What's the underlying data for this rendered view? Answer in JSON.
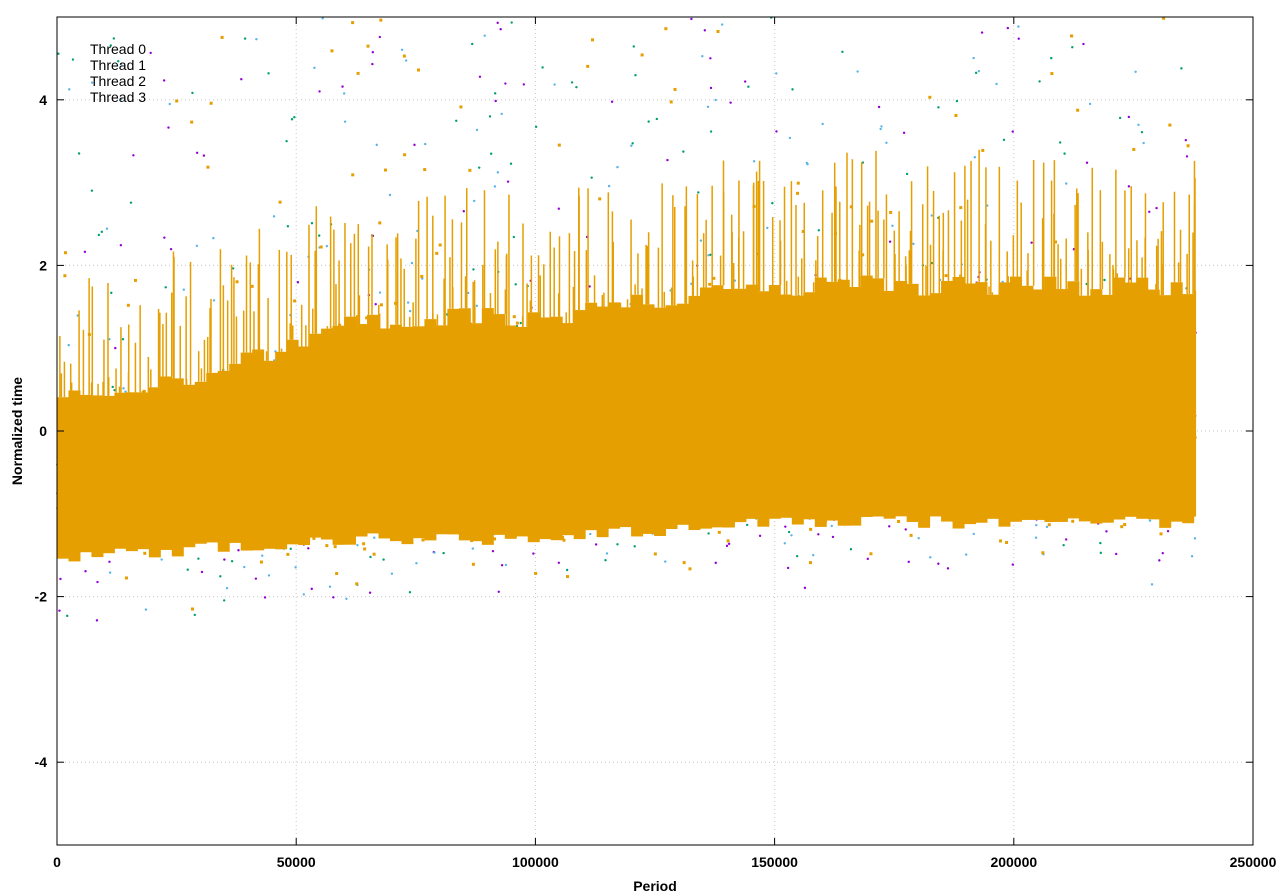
{
  "chart_data": {
    "type": "scatter",
    "title": "",
    "xlabel": "Period",
    "ylabel": "Normalized time",
    "xlim": [
      0,
      250000
    ],
    "ylim": [
      -5,
      5
    ],
    "x_ticks": [
      0,
      50000,
      100000,
      150000,
      200000,
      250000
    ],
    "x_tick_labels": [
      "0",
      "50000",
      "100000",
      "150000",
      "200000",
      "250000"
    ],
    "y_ticks": [
      -4,
      -2,
      0,
      2,
      4
    ],
    "y_tick_labels": [
      "-4",
      "-2",
      "0",
      "2",
      "4"
    ],
    "grid": true,
    "legend_position": "top-left",
    "x_data_max": 238000,
    "series": [
      {
        "name": "Thread 0",
        "color": "#9400d3",
        "marker": "dot",
        "profile": [
          {
            "x": 0,
            "center": -0.6,
            "spread": 0.9
          },
          {
            "x": 30000,
            "center": -0.4,
            "spread": 1.0
          },
          {
            "x": 66000,
            "center": -0.1,
            "spread": 1.3
          },
          {
            "x": 75000,
            "center": -0.2,
            "spread": 1.2
          },
          {
            "x": 100000,
            "center": 0.0,
            "spread": 1.3
          },
          {
            "x": 140000,
            "center": 0.2,
            "spread": 1.4
          },
          {
            "x": 148000,
            "center": 0.3,
            "spread": 1.5
          },
          {
            "x": 160000,
            "center": 0.0,
            "spread": 1.3
          },
          {
            "x": 190000,
            "center": 0.2,
            "spread": 1.4
          },
          {
            "x": 238000,
            "center": 0.3,
            "spread": 1.5
          }
        ]
      },
      {
        "name": "Thread 1",
        "color": "#009e73",
        "marker": "dot",
        "profile": [
          {
            "x": 0,
            "center": -0.6,
            "spread": 0.9
          },
          {
            "x": 66000,
            "center": -0.1,
            "spread": 1.3
          },
          {
            "x": 148000,
            "center": 0.3,
            "spread": 1.5
          },
          {
            "x": 238000,
            "center": 0.3,
            "spread": 1.5
          }
        ]
      },
      {
        "name": "Thread 2",
        "color": "#56b4e9",
        "marker": "dot",
        "profile": [
          {
            "x": 0,
            "center": -0.6,
            "spread": 1.0
          },
          {
            "x": 66000,
            "center": -0.1,
            "spread": 1.4
          },
          {
            "x": 148000,
            "center": 0.3,
            "spread": 1.6
          },
          {
            "x": 238000,
            "center": 0.3,
            "spread": 1.6
          }
        ]
      },
      {
        "name": "Thread 3",
        "color": "#e69f00",
        "marker": "square",
        "profile": [
          {
            "x": 0,
            "center": -0.6,
            "spread": 0.9
          },
          {
            "x": 30000,
            "center": -0.4,
            "spread": 1.0
          },
          {
            "x": 66000,
            "center": 0.0,
            "spread": 1.3
          },
          {
            "x": 100000,
            "center": 0.0,
            "spread": 1.3
          },
          {
            "x": 148000,
            "center": 0.3,
            "spread": 1.4
          },
          {
            "x": 238000,
            "center": 0.3,
            "spread": 1.4
          }
        ]
      }
    ]
  }
}
